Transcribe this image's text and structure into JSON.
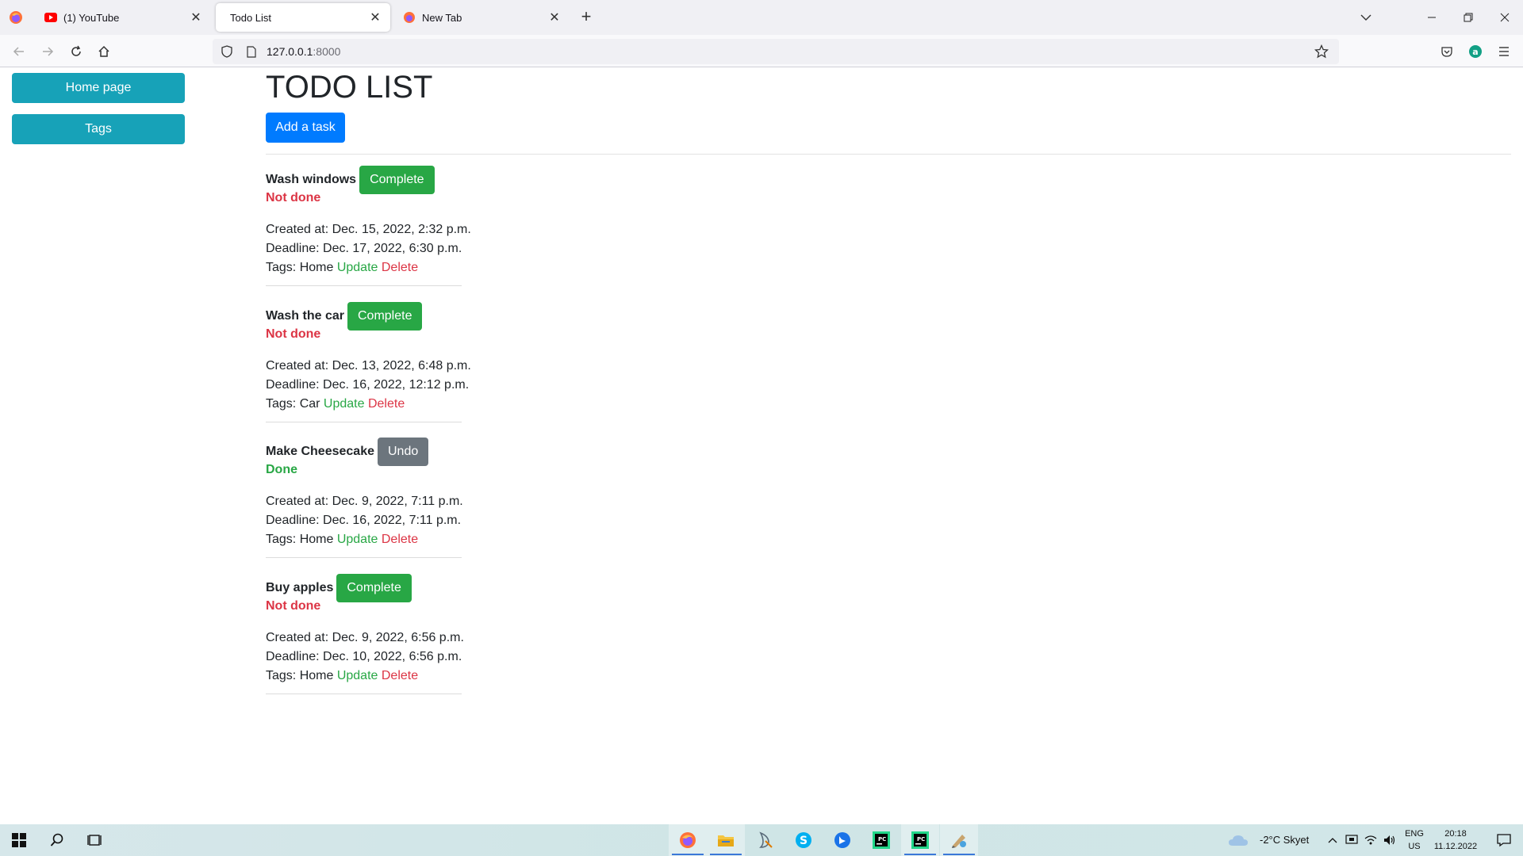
{
  "browser": {
    "tabs": [
      {
        "title": "(1) YouTube"
      },
      {
        "title": "Todo List"
      },
      {
        "title": "New Tab"
      }
    ],
    "new_tab_symbol": "+",
    "url_host": "127.0.0.1",
    "url_port": ":8000"
  },
  "sidebar": {
    "items": [
      {
        "label": "Home page"
      },
      {
        "label": "Tags"
      }
    ]
  },
  "main": {
    "title": "TODO LIST",
    "add_label": "Add a task",
    "tasks": [
      {
        "name": "Wash windows",
        "action": "Complete",
        "status": "Not done",
        "created": "Created at: Dec. 15, 2022, 2:32 p.m.",
        "deadline": "Deadline: Dec. 17, 2022, 6:30 p.m.",
        "tags": "Tags: Home",
        "update": "Update",
        "delete": "Delete"
      },
      {
        "name": "Wash the car",
        "action": "Complete",
        "status": "Not done",
        "created": "Created at: Dec. 13, 2022, 6:48 p.m.",
        "deadline": "Deadline: Dec. 16, 2022, 12:12 p.m.",
        "tags": "Tags: Car",
        "update": "Update",
        "delete": "Delete"
      },
      {
        "name": "Make Cheesecake",
        "action": "Undo",
        "status": "Done",
        "created": "Created at: Dec. 9, 2022, 7:11 p.m.",
        "deadline": "Deadline: Dec. 16, 2022, 7:11 p.m.",
        "tags": "Tags: Home",
        "update": "Update",
        "delete": "Delete"
      },
      {
        "name": "Buy apples",
        "action": "Complete",
        "status": "Not done",
        "created": "Created at: Dec. 9, 2022, 6:56 p.m.",
        "deadline": "Deadline: Dec. 10, 2022, 6:56 p.m.",
        "tags": "Tags: Home",
        "update": "Update",
        "delete": "Delete"
      }
    ]
  },
  "taskbar": {
    "weather": "-2°C  Skyet",
    "lang_top": "ENG",
    "lang_bottom": "US",
    "time": "20:18",
    "date": "11.12.2022"
  },
  "colors": {
    "primary": "#007bff",
    "info": "#17a2b8",
    "success": "#28a745",
    "danger": "#dc3545",
    "secondary": "#6c757d"
  }
}
